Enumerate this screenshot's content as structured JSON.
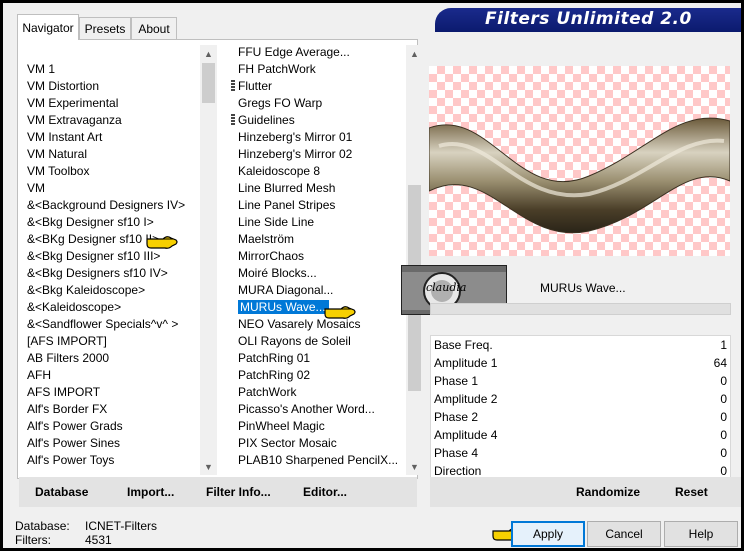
{
  "app": {
    "title": "Filters Unlimited 2.0"
  },
  "tabs": [
    {
      "label": "Navigator",
      "active": true
    },
    {
      "label": "Presets",
      "active": false
    },
    {
      "label": "About",
      "active": false
    }
  ],
  "categories": [
    "VM 1",
    "VM Distortion",
    "VM Experimental",
    "VM Extravaganza",
    "VM Instant Art",
    "VM Natural",
    "VM Toolbox",
    "VM",
    "&<Background Designers IV>",
    "&<Bkg Designer sf10 I>",
    "&<BKg Designer sf10 II>",
    "&<Bkg Designer sf10 III>",
    "&<Bkg Designers sf10 IV>",
    "&<Bkg Kaleidoscope>",
    "&<Kaleidoscope>",
    "&<Sandflower Specials^v^ >",
    "[AFS IMPORT]",
    "AB Filters 2000",
    "AFH",
    "AFS IMPORT",
    "Alf's Border FX",
    "Alf's Power Grads",
    "Alf's Power Sines",
    "Alf's Power Toys"
  ],
  "filters": [
    {
      "label": "FFU Edge Average...",
      "group": false
    },
    {
      "label": "FH PatchWork",
      "group": false
    },
    {
      "label": "Flutter",
      "group": true
    },
    {
      "label": "Gregs FO Warp",
      "group": false
    },
    {
      "label": "Guidelines",
      "group": true
    },
    {
      "label": "Hinzeberg's Mirror 01",
      "group": false
    },
    {
      "label": "Hinzeberg's Mirror 02",
      "group": false
    },
    {
      "label": "Kaleidoscope 8",
      "group": false
    },
    {
      "label": "Line Blurred Mesh",
      "group": false
    },
    {
      "label": "Line Panel Stripes",
      "group": false
    },
    {
      "label": "Line Side Line",
      "group": false
    },
    {
      "label": "Maelström",
      "group": false
    },
    {
      "label": "MirrorChaos",
      "group": false
    },
    {
      "label": "Moiré Blocks...",
      "group": false
    },
    {
      "label": "MURA Diagonal...",
      "group": false
    },
    {
      "label": "MURUs Wave...",
      "group": false,
      "selected": true
    },
    {
      "label": "NEO Vasarely Mosaics",
      "group": false
    },
    {
      "label": "OLI Rayons de Soleil",
      "group": false
    },
    {
      "label": "PatchRing 01",
      "group": false
    },
    {
      "label": "PatchRing 02",
      "group": false
    },
    {
      "label": "PatchWork",
      "group": false
    },
    {
      "label": "Picasso's Another Word...",
      "group": false
    },
    {
      "label": "PinWheel Magic",
      "group": false
    },
    {
      "label": "PIX Sector Mosaic",
      "group": false
    },
    {
      "label": "PLAB10 Sharpened PencilX...",
      "group": false
    }
  ],
  "left_buttons": {
    "database": "Database",
    "import": "Import...",
    "filter_info": "Filter Info...",
    "editor": "Editor..."
  },
  "preview": {
    "filter_name": "MURUs Wave...",
    "logo_text": "claudia"
  },
  "parameters": [
    {
      "name": "Base Freq.",
      "value": "1"
    },
    {
      "name": "Amplitude 1",
      "value": "64"
    },
    {
      "name": "Phase 1",
      "value": "0"
    },
    {
      "name": "Amplitude 2",
      "value": "0"
    },
    {
      "name": "Phase 2",
      "value": "0"
    },
    {
      "name": "Amplitude 4",
      "value": "0"
    },
    {
      "name": "Phase 4",
      "value": "0"
    },
    {
      "name": "Direction",
      "value": "0"
    }
  ],
  "right_buttons": {
    "randomize": "Randomize",
    "reset": "Reset"
  },
  "status": {
    "database_label": "Database:",
    "database_value": "ICNET-Filters",
    "filters_label": "Filters:",
    "filters_value": "4531"
  },
  "dialog_buttons": {
    "apply": "Apply",
    "cancel": "Cancel",
    "help": "Help"
  },
  "colors": {
    "banner": "#0b1a6e",
    "selection": "#0078d7",
    "checker": "#ffc8c8"
  }
}
